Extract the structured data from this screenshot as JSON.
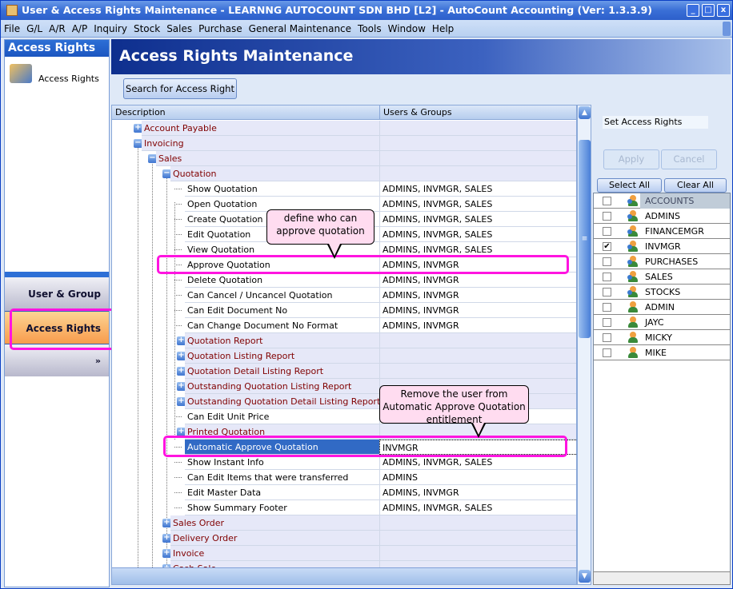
{
  "window": {
    "title": "User & Access Rights Maintenance - LEARNNG AUTOCOUNT SDN BHD [L2] - AutoCount Accounting (Ver: 1.3.3.9)",
    "min": "_",
    "max": "□",
    "close": "x"
  },
  "menu": [
    "File",
    "G/L",
    "A/R",
    "A/P",
    "Inquiry",
    "Stock",
    "Sales",
    "Purchase",
    "General Maintenance",
    "Tools",
    "Window",
    "Help"
  ],
  "left": {
    "header": "Access Rights",
    "item": "Access Rights",
    "nav": [
      "User & Group",
      "Access Rights"
    ],
    "more": "»"
  },
  "main": {
    "title": "Access Rights Maintenance",
    "search_button": "Search for Access Right",
    "columns": [
      "Description",
      "Users & Groups"
    ],
    "rows": [
      {
        "label": "Account Payable",
        "level": 0,
        "group": true,
        "state": "+",
        "users": ""
      },
      {
        "label": "Invoicing",
        "level": 0,
        "group": true,
        "state": "-",
        "users": ""
      },
      {
        "label": "Sales",
        "level": 1,
        "group": true,
        "state": "-",
        "users": ""
      },
      {
        "label": "Quotation",
        "level": 2,
        "group": true,
        "state": "-",
        "users": ""
      },
      {
        "label": "Show Quotation",
        "level": 3,
        "users": "ADMINS, INVMGR, SALES"
      },
      {
        "label": "Open Quotation",
        "level": 3,
        "users": "ADMINS, INVMGR, SALES"
      },
      {
        "label": "Create Quotation",
        "level": 3,
        "users": "ADMINS, INVMGR, SALES"
      },
      {
        "label": "Edit Quotation",
        "level": 3,
        "users": "ADMINS, INVMGR, SALES"
      },
      {
        "label": "View Quotation",
        "level": 3,
        "users": "ADMINS, INVMGR, SALES"
      },
      {
        "label": "Approve Quotation",
        "level": 3,
        "users": "ADMINS, INVMGR"
      },
      {
        "label": "Delete Quotation",
        "level": 3,
        "users": "ADMINS, INVMGR"
      },
      {
        "label": "Can Cancel / Uncancel Quotation",
        "level": 3,
        "users": "ADMINS, INVMGR"
      },
      {
        "label": "Can Edit Document No",
        "level": 3,
        "users": "ADMINS, INVMGR"
      },
      {
        "label": "Can Change Document No Format",
        "level": 3,
        "users": "ADMINS, INVMGR"
      },
      {
        "label": "Quotation Report",
        "level": 3,
        "group": true,
        "state": "+",
        "users": ""
      },
      {
        "label": "Quotation Listing Report",
        "level": 3,
        "group": true,
        "state": "+",
        "users": ""
      },
      {
        "label": "Quotation Detail Listing Report",
        "level": 3,
        "group": true,
        "state": "+",
        "users": ""
      },
      {
        "label": "Outstanding Quotation Listing Report",
        "level": 3,
        "group": true,
        "state": "+",
        "users": ""
      },
      {
        "label": "Outstanding Quotation Detail Listing Report",
        "level": 3,
        "group": true,
        "state": "+",
        "users": ""
      },
      {
        "label": "Can Edit Unit Price",
        "level": 3,
        "users": ""
      },
      {
        "label": "Printed Quotation",
        "level": 3,
        "group": true,
        "state": "+",
        "users": ""
      },
      {
        "label": "Automatic Approve Quotation",
        "level": 3,
        "selected": true,
        "users": "INVMGR"
      },
      {
        "label": "Show Instant Info",
        "level": 3,
        "users": "ADMINS, INVMGR, SALES"
      },
      {
        "label": "Can Edit Items that were transferred",
        "level": 3,
        "users": "ADMINS"
      },
      {
        "label": "Edit Master Data",
        "level": 3,
        "users": "ADMINS, INVMGR"
      },
      {
        "label": "Show Summary Footer",
        "level": 3,
        "users": "ADMINS, INVMGR, SALES"
      },
      {
        "label": "Sales Order",
        "level": 2,
        "group": true,
        "state": "+",
        "users": ""
      },
      {
        "label": "Delivery Order",
        "level": 2,
        "group": true,
        "state": "+",
        "users": ""
      },
      {
        "label": "Invoice",
        "level": 2,
        "group": true,
        "state": "+",
        "users": ""
      },
      {
        "label": "Cash Sale",
        "level": 2,
        "group": true,
        "state": "+",
        "users": ""
      }
    ]
  },
  "callouts": {
    "approve": "define who can approve quotation",
    "auto": "Remove the user from Automatic Approve Quotation entitlement"
  },
  "right": {
    "label": "Set Access Rights",
    "apply": "Apply",
    "cancel": "Cancel",
    "select_all": "Select All",
    "clear_all": "Clear All",
    "users": [
      {
        "name": "ACCOUNTS",
        "group": true,
        "checked": false
      },
      {
        "name": "ADMINS",
        "group": true,
        "checked": false
      },
      {
        "name": "FINANCEMGR",
        "group": true,
        "checked": false
      },
      {
        "name": "INVMGR",
        "group": true,
        "checked": true
      },
      {
        "name": "PURCHASES",
        "group": true,
        "checked": false
      },
      {
        "name": "SALES",
        "group": true,
        "checked": false
      },
      {
        "name": "STOCKS",
        "group": true,
        "checked": false
      },
      {
        "name": "ADMIN",
        "group": false,
        "checked": false
      },
      {
        "name": "JAYC",
        "group": false,
        "checked": false
      },
      {
        "name": "MICKY",
        "group": false,
        "checked": false
      },
      {
        "name": "MIKE",
        "group": false,
        "checked": false
      }
    ]
  },
  "colors": {
    "highlight": "#ff14e0",
    "selection": "#316ac5",
    "callout": "#ffdcf0",
    "active_nav": "#f89c4c"
  }
}
